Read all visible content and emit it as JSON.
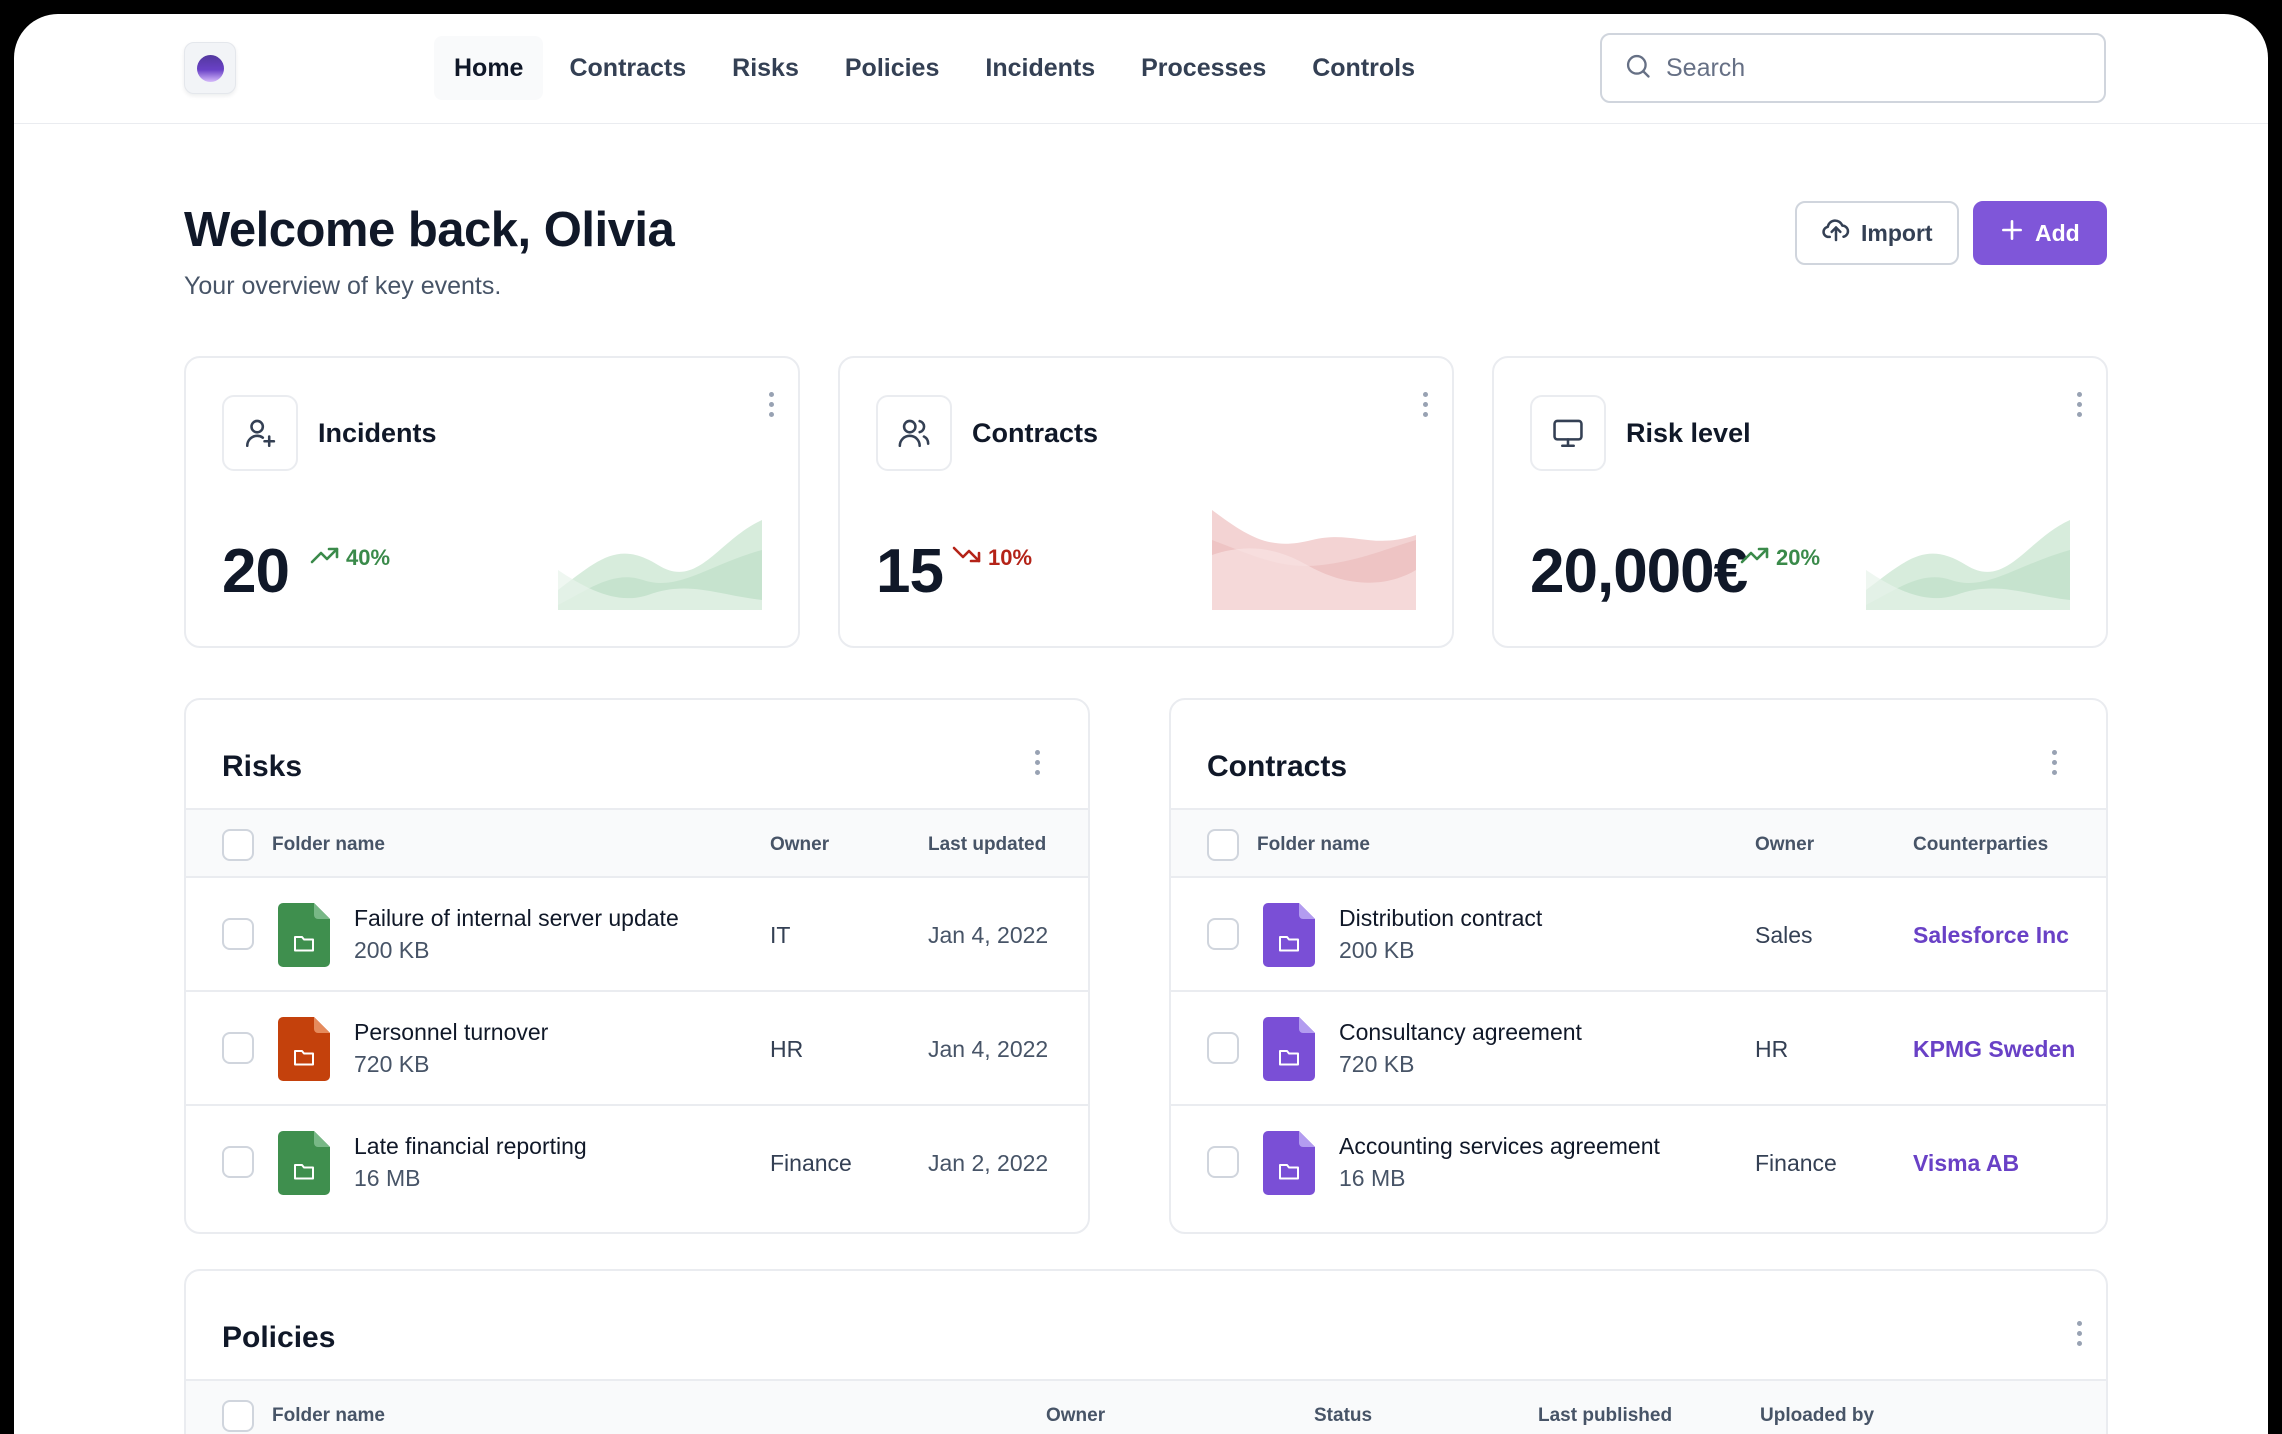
{
  "nav": {
    "items": [
      {
        "label": "Home",
        "active": true
      },
      {
        "label": "Contracts"
      },
      {
        "label": "Risks"
      },
      {
        "label": "Policies"
      },
      {
        "label": "Incidents"
      },
      {
        "label": "Processes"
      },
      {
        "label": "Controls"
      }
    ],
    "search_placeholder": "Search"
  },
  "header": {
    "title": "Welcome back, Olivia",
    "subtitle": "Your overview of key events.",
    "import_label": "Import",
    "add_label": "Add"
  },
  "stats": [
    {
      "title": "Incidents",
      "value": "20",
      "trend": "40%",
      "direction": "up",
      "icon": "user-plus-icon",
      "color": "#3a8a4a"
    },
    {
      "title": "Contracts",
      "value": "15",
      "trend": "10%",
      "direction": "down",
      "icon": "users-icon",
      "color": "#b42318"
    },
    {
      "title": "Risk level",
      "value": "20,000€",
      "trend": "20%",
      "direction": "up",
      "icon": "monitor-icon",
      "color": "#3a8a4a"
    }
  ],
  "risks": {
    "title": "Risks",
    "columns": [
      "Folder name",
      "Owner",
      "Last updated"
    ],
    "rows": [
      {
        "name": "Failure of internal server update",
        "size": "200 KB",
        "owner": "IT",
        "date": "Jan 4, 2022",
        "color": "#3f8f4e"
      },
      {
        "name": "Personnel turnover",
        "size": "720 KB",
        "owner": "HR",
        "date": "Jan 4, 2022",
        "color": "#c4410c"
      },
      {
        "name": "Late financial reporting",
        "size": "16 MB",
        "owner": "Finance",
        "date": "Jan 2, 2022",
        "color": "#3f8f4e"
      }
    ]
  },
  "contracts": {
    "title": "Contracts",
    "columns": [
      "Folder name",
      "Owner",
      "Counterparties"
    ],
    "rows": [
      {
        "name": "Distribution contract",
        "size": "200 KB",
        "owner": "Sales",
        "counterparty": "Salesforce Inc",
        "color": "#7a4fd6"
      },
      {
        "name": "Consultancy agreement",
        "size": "720 KB",
        "owner": "HR",
        "counterparty": "KPMG Sweden",
        "color": "#7a4fd6"
      },
      {
        "name": "Accounting services agreement",
        "size": "16 MB",
        "owner": "Finance",
        "counterparty": "Visma AB",
        "color": "#7a4fd6"
      }
    ]
  },
  "policies": {
    "title": "Policies",
    "columns": [
      "Folder name",
      "Owner",
      "Status",
      "Last published",
      "Uploaded by"
    ]
  },
  "colors": {
    "accent": "#7f56d9",
    "link": "#6941c6",
    "up": "#3a8a4a",
    "down": "#b42318"
  }
}
